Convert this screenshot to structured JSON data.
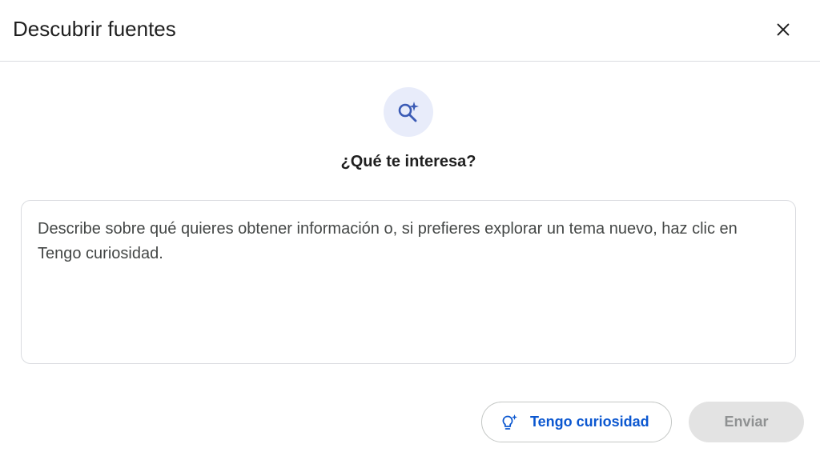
{
  "dialog": {
    "title": "Descubrir fuentes",
    "close_icon": "close-icon"
  },
  "hero": {
    "icon": "search-sparkle-icon",
    "icon_bg_color": "#e8ecfa",
    "icon_color": "#3b5bb5",
    "question": "¿Qué te interesa?"
  },
  "topic_input": {
    "value": "",
    "placeholder": "Describe sobre qué quieres obtener información o, si prefieres explorar un tema nuevo, haz clic en Tengo curiosidad."
  },
  "actions": {
    "curious": {
      "label": "Tengo curiosidad",
      "icon": "lightbulb-sparkle-icon",
      "color": "#0b57d0"
    },
    "send": {
      "label": "Enviar",
      "disabled": true
    }
  }
}
